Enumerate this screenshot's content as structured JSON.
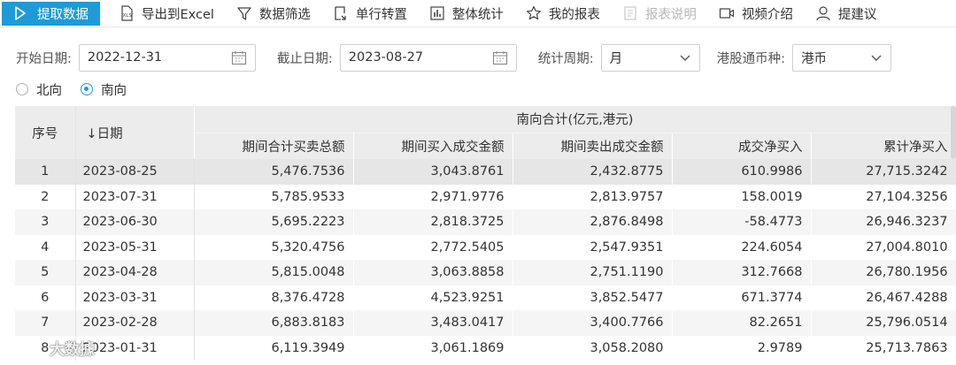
{
  "toolbar": {
    "items": [
      {
        "label": "提取数据",
        "icon": "play-icon"
      },
      {
        "label": "导出到Excel",
        "icon": "excel-icon"
      },
      {
        "label": "数据筛选",
        "icon": "filter-icon"
      },
      {
        "label": "单行转置",
        "icon": "transpose-icon"
      },
      {
        "label": "整体统计",
        "icon": "bar-chart-icon"
      },
      {
        "label": "我的报表",
        "icon": "star-icon"
      },
      {
        "label": "报表说明",
        "icon": "document-icon"
      },
      {
        "label": "视频介绍",
        "icon": "video-icon"
      },
      {
        "label": "提建议",
        "icon": "user-icon"
      }
    ]
  },
  "filters": {
    "start_label": "开始日期:",
    "start_value": "2022-12-31",
    "end_label": "截止日期:",
    "end_value": "2023-08-27",
    "period_label": "统计周期:",
    "period_value": "月",
    "currency_label": "港股通币种:",
    "currency_value": "港币"
  },
  "direction": {
    "options": [
      "北向",
      "南向"
    ],
    "selected": "南向"
  },
  "table": {
    "col_seq": "序号",
    "col_date": "↓日期",
    "group_title": "南向合计(亿元,港元)",
    "sub_columns": [
      "期间合计买卖总额",
      "期间买入成交金额",
      "期间卖出成交金额",
      "成交净买入",
      "累计净买入"
    ],
    "rows": [
      {
        "seq": "1",
        "date": "2023-08-25",
        "total": "5,476.7536",
        "buy": "3,043.8761",
        "sell": "2,432.8775",
        "net": "610.9986",
        "cum": "27,715.3242"
      },
      {
        "seq": "2",
        "date": "2023-07-31",
        "total": "5,785.9533",
        "buy": "2,971.9776",
        "sell": "2,813.9757",
        "net": "158.0019",
        "cum": "27,104.3256"
      },
      {
        "seq": "3",
        "date": "2023-06-30",
        "total": "5,695.2223",
        "buy": "2,818.3725",
        "sell": "2,876.8498",
        "net": "-58.4773",
        "cum": "26,946.3237"
      },
      {
        "seq": "4",
        "date": "2023-05-31",
        "total": "5,320.4756",
        "buy": "2,772.5405",
        "sell": "2,547.9351",
        "net": "224.6054",
        "cum": "27,004.8010"
      },
      {
        "seq": "5",
        "date": "2023-04-28",
        "total": "5,815.0048",
        "buy": "3,063.8858",
        "sell": "2,751.1190",
        "net": "312.7668",
        "cum": "26,780.1956"
      },
      {
        "seq": "6",
        "date": "2023-03-31",
        "total": "8,376.4728",
        "buy": "4,523.9251",
        "sell": "3,852.5477",
        "net": "671.3774",
        "cum": "26,467.4288"
      },
      {
        "seq": "7",
        "date": "2023-02-28",
        "total": "6,883.8183",
        "buy": "3,483.0417",
        "sell": "3,400.7766",
        "net": "82.2651",
        "cum": "25,796.0514"
      },
      {
        "seq": "8",
        "date": "2023-01-31",
        "total": "6,119.3949",
        "buy": "3,061.1869",
        "sell": "3,058.2080",
        "net": "2.9789",
        "cum": "25,713.7863"
      }
    ]
  },
  "watermark": {
    "text": "大数據"
  },
  "colors": {
    "accent": "#1e9bd7",
    "header_bg": "#ececec",
    "row_alt": "#f5f5f5"
  }
}
